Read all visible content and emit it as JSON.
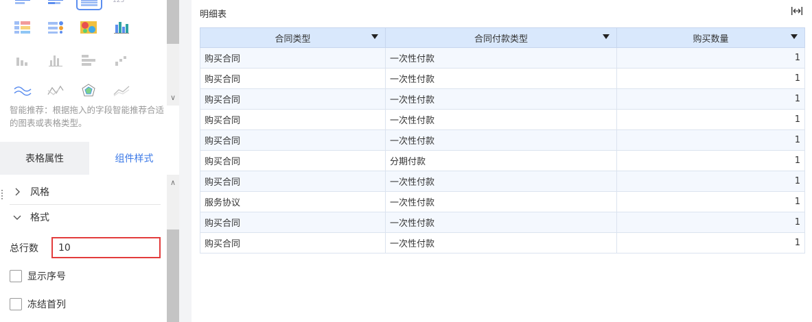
{
  "left_panel": {
    "smart_hint": "智能推荐：根据拖入的字段智能推荐合适的图表或表格类型。",
    "tabs": {
      "table_properties": "表格属性",
      "component_style": "组件样式",
      "active": "component_style"
    },
    "sections": {
      "style": "风格",
      "format": "格式"
    },
    "format": {
      "total_rows_label": "总行数",
      "total_rows_value": "10",
      "show_index_label": "显示序号",
      "show_index_checked": false,
      "freeze_first_col_label": "冻结首列",
      "freeze_first_col_checked": false
    },
    "chart_type_icons": [
      "bar-chart-icon",
      "stacked-bar-icon",
      "detail-table-icon",
      "kpi-number-icon",
      "color-table-icon",
      "dot-table-icon",
      "heatmap-icon",
      "grouped-column-icon",
      "column-chart-icon",
      "multi-column-icon",
      "stacked-row-icon",
      "step-chart-icon",
      "wave-line-icon",
      "zigzag-line-icon",
      "radar-chart-icon",
      "area-line-icon"
    ],
    "selected_chart_type": "detail-table-icon"
  },
  "widget": {
    "title": "明细表",
    "expand_icon": "expand-width-icon"
  },
  "table": {
    "columns": [
      "合同类型",
      "合同付款类型",
      "购买数量"
    ],
    "rows": [
      [
        "购买合同",
        "一次性付款",
        "1"
      ],
      [
        "购买合同",
        "一次性付款",
        "1"
      ],
      [
        "购买合同",
        "一次性付款",
        "1"
      ],
      [
        "购买合同",
        "一次性付款",
        "1"
      ],
      [
        "购买合同",
        "一次性付款",
        "1"
      ],
      [
        "购买合同",
        "分期付款",
        "1"
      ],
      [
        "购买合同",
        "一次性付款",
        "1"
      ],
      [
        "服务协议",
        "一次性付款",
        "1"
      ],
      [
        "购买合同",
        "一次性付款",
        "1"
      ],
      [
        "购买合同",
        "一次性付款",
        "1"
      ]
    ]
  },
  "colors": {
    "accent": "#3a78e7",
    "header_bg": "#d9e8fc",
    "highlight_border": "#e23b3b"
  }
}
